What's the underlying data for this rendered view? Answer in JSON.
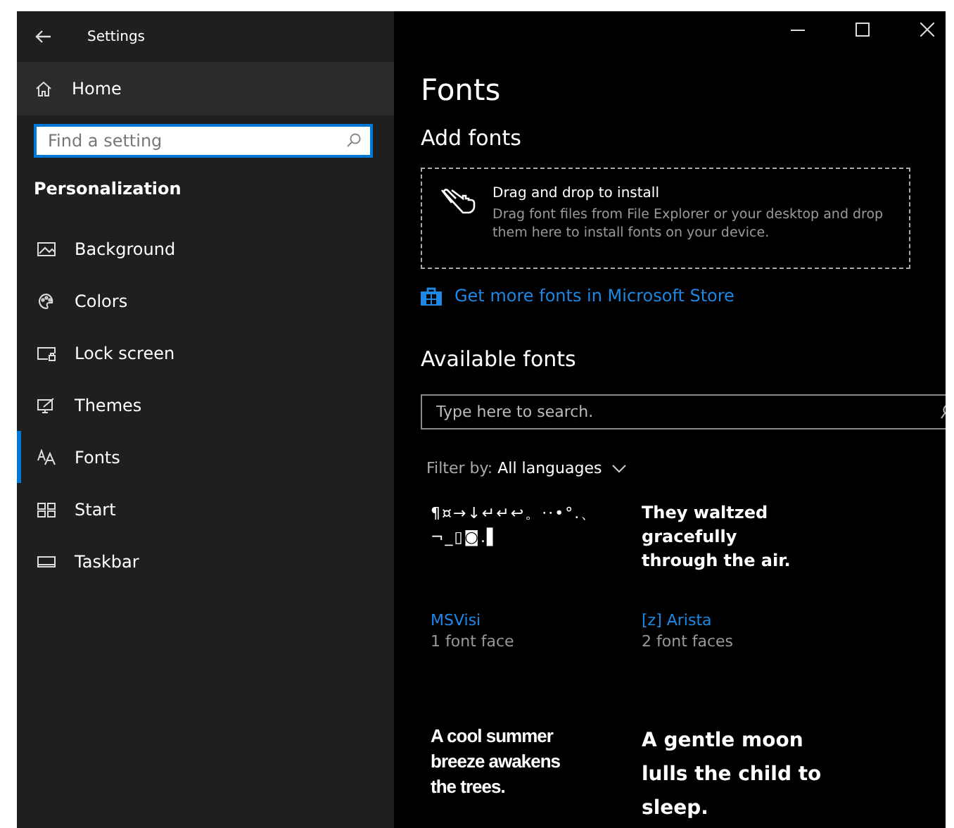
{
  "window": {
    "title": "Settings"
  },
  "sidebar": {
    "home": "Home",
    "search": {
      "placeholder": "Find a setting"
    },
    "section": "Personalization",
    "items": [
      {
        "label": "Background",
        "kind": "background",
        "selected": false
      },
      {
        "label": "Colors",
        "kind": "colors",
        "selected": false
      },
      {
        "label": "Lock screen",
        "kind": "lock",
        "selected": false
      },
      {
        "label": "Themes",
        "kind": "themes",
        "selected": false
      },
      {
        "label": "Fonts",
        "kind": "fonts",
        "selected": true
      },
      {
        "label": "Start",
        "kind": "start",
        "selected": false
      },
      {
        "label": "Taskbar",
        "kind": "taskbar",
        "selected": false
      }
    ]
  },
  "page": {
    "title": "Fonts",
    "add_heading": "Add fonts",
    "drop": {
      "title": "Drag and drop to install",
      "text": "Drag font files from File Explorer or your desktop and drop them here to install fonts on your device."
    },
    "store_link": "Get more fonts in Microsoft Store",
    "available_heading": "Available fonts",
    "search": {
      "placeholder": "Type here to search."
    },
    "filter": {
      "label": "Filter by:",
      "value": "All languages"
    },
    "fonts": [
      {
        "sample": "¶¤→↓↵↵↩。··•°.、 ¬_▯◙.▌",
        "kind": "symbol",
        "name": "MSVisi",
        "faces": "1 font face"
      },
      {
        "sample": "They waltzed gracefully through the air.",
        "kind": "rounded",
        "name": "[z] Arista",
        "faces": "2 font faces"
      },
      {
        "sample": "A cool summer breeze awakens the trees.",
        "kind": "heavy"
      },
      {
        "sample": "A gentle moon lulls the child to sleep.",
        "kind": "wide"
      }
    ]
  }
}
